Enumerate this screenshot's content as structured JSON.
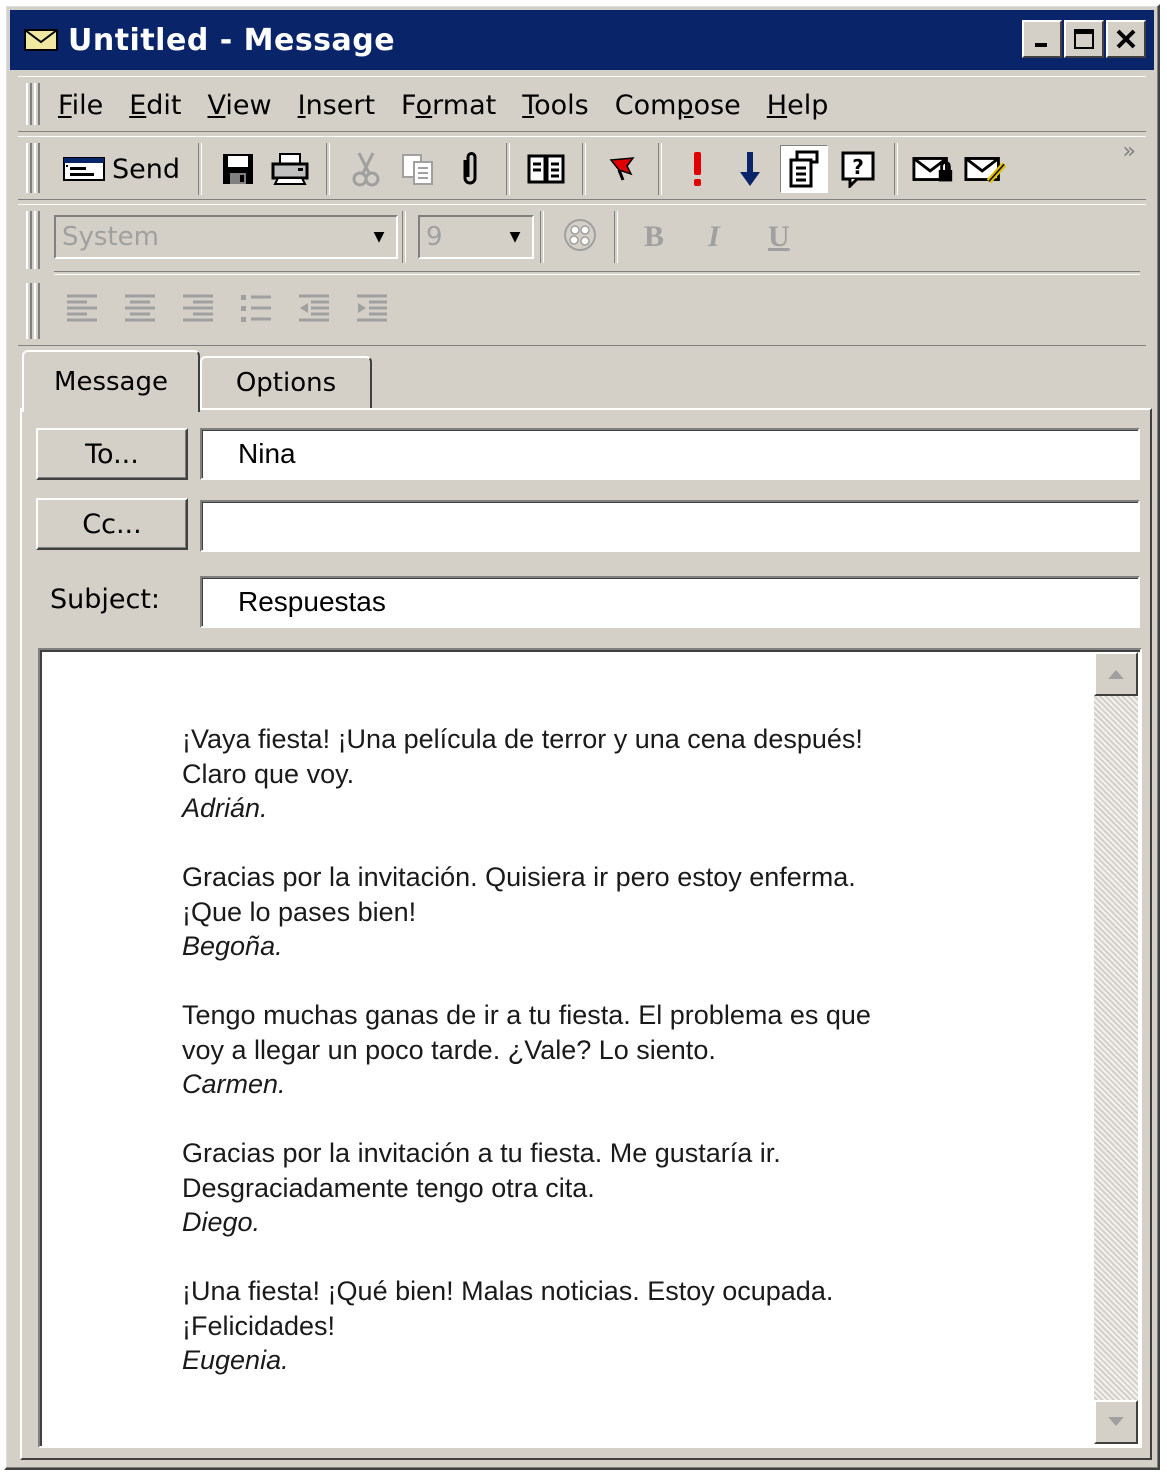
{
  "window": {
    "title": "Untitled - Message",
    "controls": [
      "minimize",
      "maximize",
      "close"
    ]
  },
  "menu": {
    "items": [
      {
        "label": "File",
        "mnemonic": "F"
      },
      {
        "label": "Edit",
        "mnemonic": "E"
      },
      {
        "label": "View",
        "mnemonic": "V"
      },
      {
        "label": "Insert",
        "mnemonic": "I"
      },
      {
        "label": "Format",
        "mnemonic": "o"
      },
      {
        "label": "Tools",
        "mnemonic": "T"
      },
      {
        "label": "Compose",
        "mnemonic": "p"
      },
      {
        "label": "Help",
        "mnemonic": "H"
      }
    ]
  },
  "toolbar": {
    "send_label": "Send",
    "overflow": "»",
    "icons": [
      "send-icon",
      "save-icon",
      "print-icon",
      "cut-icon",
      "copy-icon",
      "attach-icon",
      "address-book-icon",
      "flag-icon",
      "high-priority-icon",
      "low-priority-icon",
      "properties-icon",
      "help-icon",
      "encrypt-icon",
      "sign-icon"
    ]
  },
  "format": {
    "font": "System",
    "size": "9",
    "bold": "B",
    "italic": "I",
    "underline": "U"
  },
  "tabs": {
    "message": "Message",
    "options": "Options"
  },
  "fields": {
    "to_button": "To...",
    "to_value": "Nina",
    "cc_button": "Cc...",
    "cc_value": "",
    "subject_label": "Subject:",
    "subject_value": "Respuestas"
  },
  "body": {
    "paragraphs": [
      {
        "lines": [
          "¡Vaya fiesta!  ¡Una película de terror y una cena después!",
          "Claro que voy."
        ],
        "signature": "Adrián."
      },
      {
        "lines": [
          "Gracias por la invitación.  Quisiera ir pero estoy enferma.",
          "¡Que lo pases bien!"
        ],
        "signature": "Begoña."
      },
      {
        "lines": [
          "Tengo muchas ganas de ir a tu fiesta.  El problema es que",
          "voy a llegar un poco tarde.  ¿Vale?  Lo siento."
        ],
        "signature": "Carmen."
      },
      {
        "lines": [
          "Gracias por la invitación a tu fiesta.  Me gustaría ir.",
          "Desgraciadamente tengo otra cita."
        ],
        "signature": "Diego."
      },
      {
        "lines": [
          "¡Una fiesta!  ¡Qué bien!  Malas noticias.  Estoy ocupada.",
          "¡Felicidades!"
        ],
        "signature": "Eugenia."
      }
    ]
  }
}
